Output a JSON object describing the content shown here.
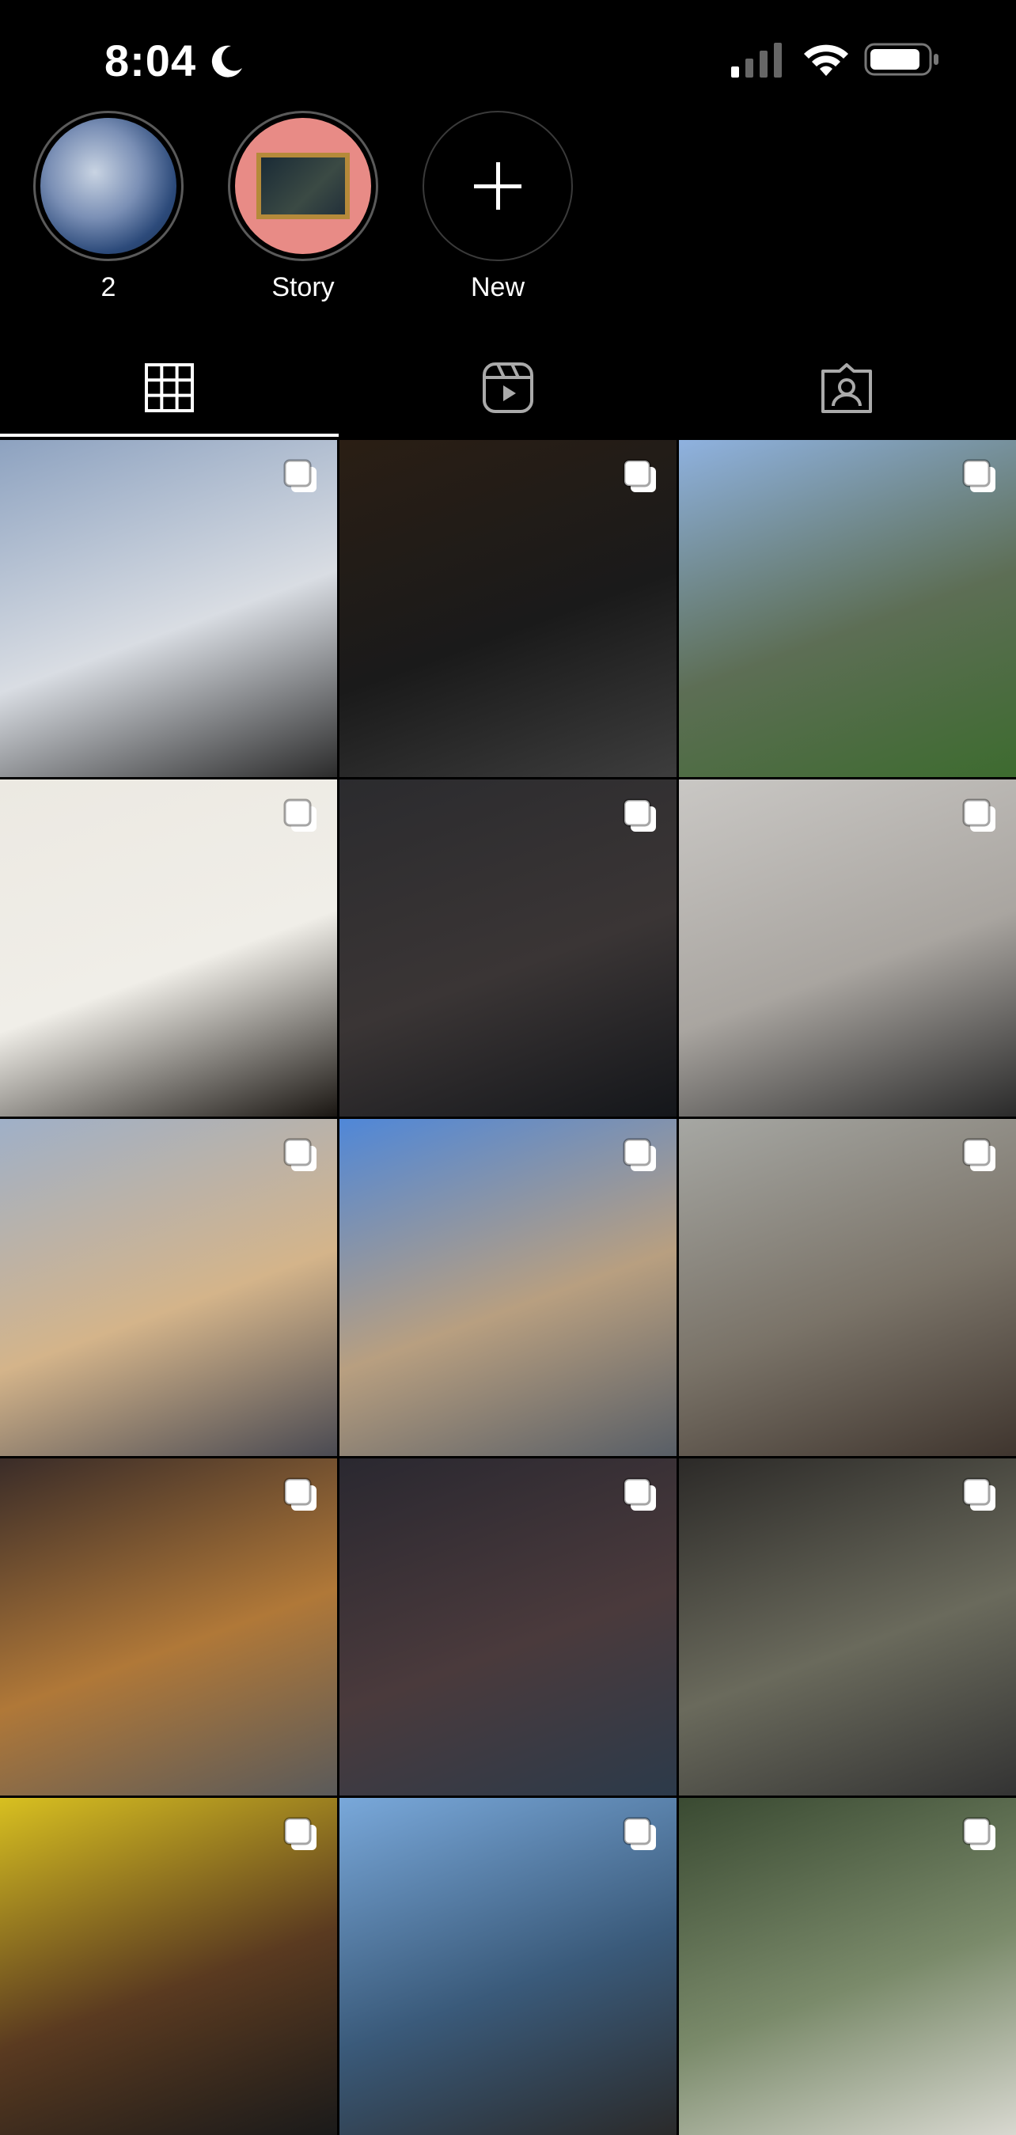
{
  "status": {
    "time": "8:04"
  },
  "highlights": [
    {
      "label": "2"
    },
    {
      "label": "Story"
    },
    {
      "label": "New"
    }
  ],
  "tabs": [
    {
      "icon": "grid-icon"
    },
    {
      "icon": "reels-icon"
    },
    {
      "icon": "tagged-icon"
    }
  ],
  "posts": [
    {
      "icon": "multi-photo-icon",
      "colors": [
        "#8da2c0",
        "#d9dde3",
        "#2b2b2b"
      ]
    },
    {
      "icon": "multi-photo-icon",
      "colors": [
        "#2a1e14",
        "#1a1a1a",
        "#3d3d3d"
      ]
    },
    {
      "icon": "multi-photo-icon",
      "colors": [
        "#8fb2e0",
        "#5d6e55",
        "#3d6b2f"
      ]
    },
    {
      "icon": "multi-photo-icon",
      "colors": [
        "#ece9e2",
        "#f0eee8",
        "#1a1612"
      ]
    },
    {
      "icon": "multi-photo-icon",
      "colors": [
        "#2b2b2e",
        "#3a3535",
        "#14161a"
      ]
    },
    {
      "icon": "multi-photo-icon",
      "colors": [
        "#c9c7c4",
        "#a9a5a0",
        "#2a2a2a"
      ]
    },
    {
      "icon": "multi-photo-icon",
      "colors": [
        "#9fb0c8",
        "#d4b48a",
        "#4a4a52"
      ]
    },
    {
      "icon": "multi-photo-icon",
      "colors": [
        "#4f87d8",
        "#b89f80",
        "#585e66"
      ]
    },
    {
      "icon": "multi-photo-icon",
      "colors": [
        "#a6a7a3",
        "#7a7368",
        "#3f352e"
      ]
    },
    {
      "icon": "multi-photo-icon",
      "colors": [
        "#3a2c28",
        "#b07838",
        "#5a5a5a"
      ]
    },
    {
      "icon": "multi-photo-icon",
      "colors": [
        "#2a2830",
        "#4a3a3c",
        "#2c3a4a"
      ]
    },
    {
      "icon": "multi-photo-icon",
      "colors": [
        "#2c2a28",
        "#6a6a5c",
        "#333"
      ]
    },
    {
      "icon": "multi-photo-icon",
      "colors": [
        "#d8c020",
        "#5a3a20",
        "#1a1a1a"
      ]
    },
    {
      "icon": "multi-photo-icon",
      "colors": [
        "#79a8da",
        "#3a5a7a",
        "#2a2a2a"
      ]
    },
    {
      "icon": "multi-photo-icon",
      "colors": [
        "#3a4a32",
        "#7a8a6a",
        "#d8d8d0"
      ]
    }
  ]
}
